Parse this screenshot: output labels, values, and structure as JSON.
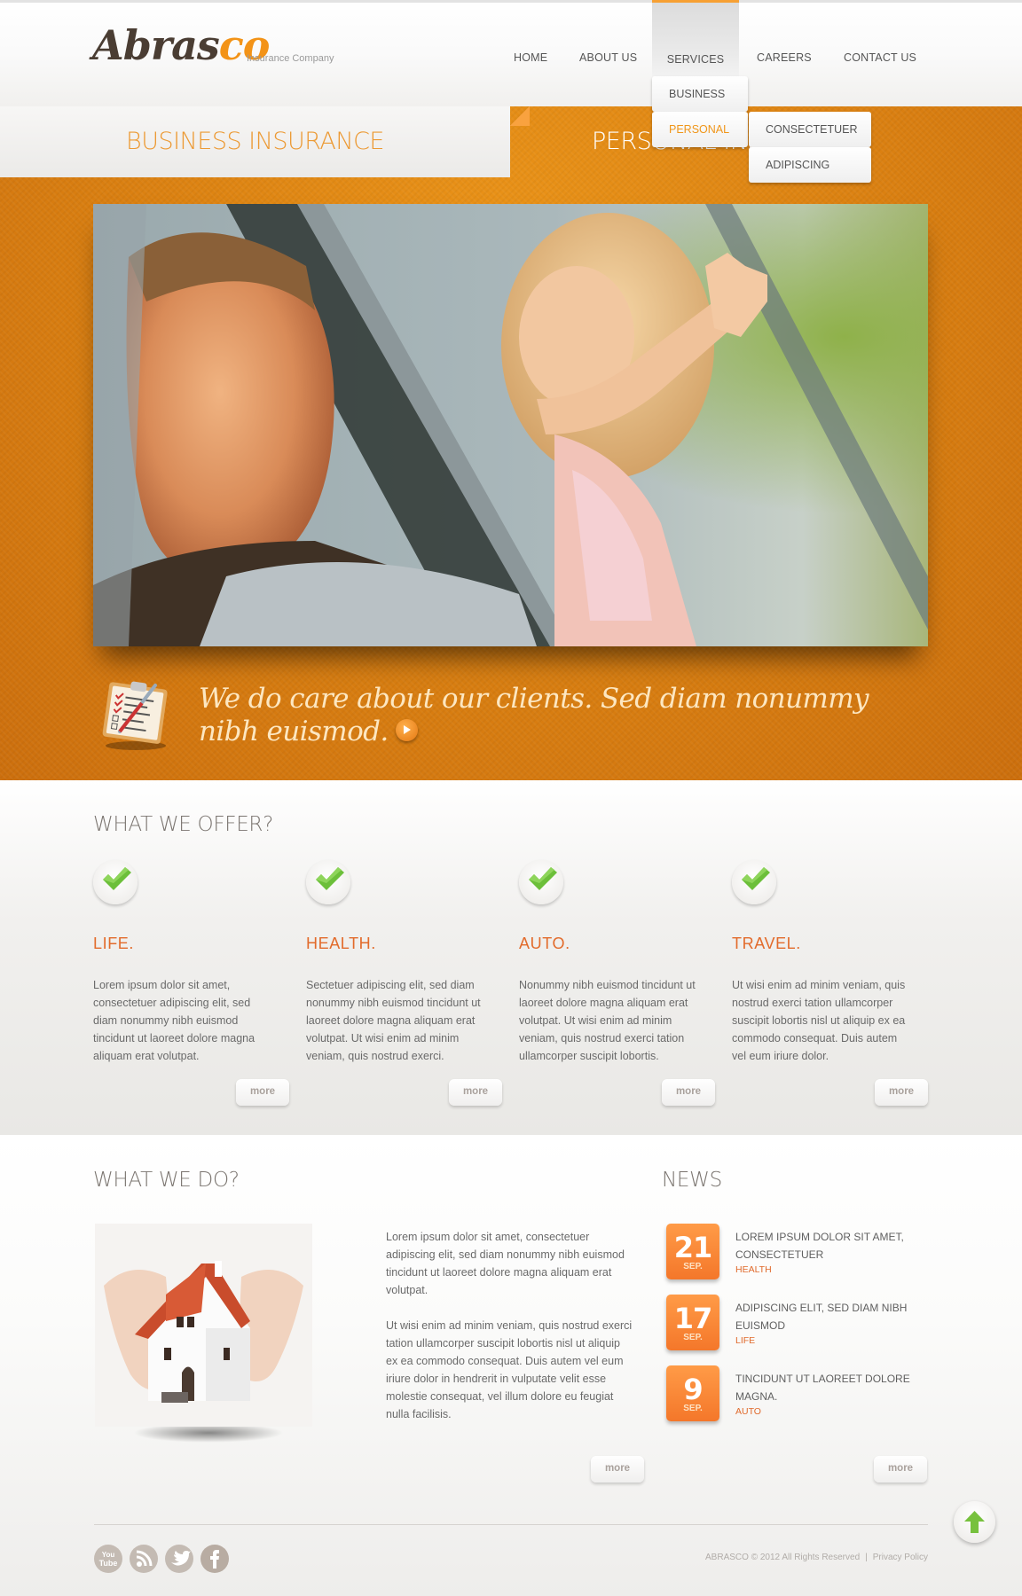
{
  "header": {
    "logo_main": "Abras",
    "logo_accent": "co",
    "tagline": "Insurance Company"
  },
  "nav": {
    "items": [
      {
        "label": "HOME",
        "active": false
      },
      {
        "label": "ABOUT US",
        "active": false
      },
      {
        "label": "SERVICES",
        "active": true
      },
      {
        "label": "CAREERS",
        "active": false
      },
      {
        "label": "CONTACT US",
        "active": false
      }
    ],
    "services_dropdown": [
      {
        "label": "BUSINESS",
        "active": false
      },
      {
        "label": "PERSONAL",
        "active": true
      }
    ],
    "personal_submenu": [
      {
        "label": "CONSECTETUER"
      },
      {
        "label": "ADIPISCING"
      }
    ]
  },
  "tabs": {
    "left": "BUSINESS INSURANCE",
    "right": "PERSONAL INSURANCE"
  },
  "hero": {
    "image_alt": "Smiling man and girl waving from car windows",
    "slogan": "We do care about our clients. Sed diam nonummy nibh euismod.",
    "slogan_icon": "clipboard-checklist-icon",
    "arrow_icon": "arrow-right-circle-icon"
  },
  "offer": {
    "title": "WHAT WE OFFER?",
    "items": [
      {
        "heading": "LIFE.",
        "body": "Lorem ipsum dolor sit amet, consectetuer adipiscing elit, sed diam nonummy nibh euismod tincidunt ut laoreet dolore magna aliquam erat volutpat.",
        "more": "more"
      },
      {
        "heading": "HEALTH.",
        "body": "Sectetuer adipiscing elit, sed diam nonummy nibh euismod tincidunt ut laoreet dolore magna aliquam erat volutpat. Ut wisi enim ad minim veniam, quis nostrud exerci.",
        "more": "more"
      },
      {
        "heading": "AUTO.",
        "body": "Nonummy nibh euismod tincidunt ut laoreet dolore magna aliquam erat volutpat. Ut wisi enim ad minim veniam, quis nostrud exerci tation ullamcorper suscipit lobortis.",
        "more": "more"
      },
      {
        "heading": "TRAVEL.",
        "body": "Ut wisi enim ad minim veniam, quis nostrud exerci tation ullamcorper suscipit lobortis nisl ut aliquip ex ea commodo consequat. Duis autem vel eum iriure dolor.",
        "more": "more"
      }
    ]
  },
  "what_we_do": {
    "title": "WHAT WE DO?",
    "image_alt": "Hands protecting a model house",
    "paragraphs": [
      "Lorem ipsum dolor sit amet, consectetuer adipiscing elit, sed diam nonummy nibh euismod tincidunt ut laoreet dolore magna aliquam erat volutpat.",
      "Ut wisi enim ad minim veniam, quis nostrud exerci tation ullamcorper suscipit lobortis nisl ut aliquip ex ea commodo consequat. Duis autem vel eum iriure dolor in hendrerit in vulputate velit esse molestie consequat, vel illum dolore eu feugiat nulla facilisis."
    ],
    "more": "more"
  },
  "news": {
    "title": "NEWS",
    "items": [
      {
        "day": "21",
        "month": "SEP.",
        "title": "LOREM IPSUM DOLOR SIT AMET, CONSECTETUER",
        "category": "HEALTH"
      },
      {
        "day": "17",
        "month": "SEP.",
        "title": "ADIPISCING ELIT, SED DIAM NIBH EUISMOD",
        "category": "LIFE"
      },
      {
        "day": "9",
        "month": "SEP.",
        "title": "TINCIDUNT UT LAOREET DOLORE MAGNA.",
        "category": "AUTO"
      }
    ],
    "more": "more"
  },
  "footer": {
    "social": [
      {
        "name": "youtube",
        "icon": "youtube-icon",
        "label": "You Tube"
      },
      {
        "name": "rss",
        "icon": "rss-icon"
      },
      {
        "name": "twitter",
        "icon": "twitter-icon"
      },
      {
        "name": "facebook",
        "icon": "facebook-icon",
        "label": "f"
      }
    ],
    "copyright": "ABRASCO © 2012 All Rights Reserved",
    "separator": "|",
    "privacy": "Privacy Policy",
    "to_top_icon": "arrow-up-icon"
  },
  "colors": {
    "accent_orange": "#f39317",
    "heading_orange": "#e26b2b",
    "band_orange": "#dd8312",
    "date_box": "#f4772a",
    "check_green": "#6cbf3a",
    "text_gray": "#6a6a6a"
  }
}
